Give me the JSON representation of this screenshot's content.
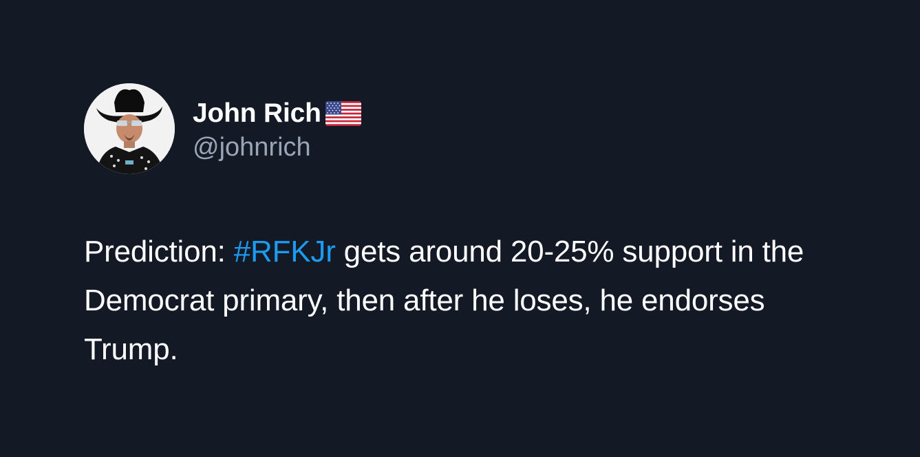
{
  "author": {
    "display_name": "John Rich",
    "flag_icon": "us-flag-icon",
    "handle": "@johnrich"
  },
  "tweet": {
    "text_before": "Prediction: ",
    "hashtag": "#RFKJr",
    "text_after": " gets around 20-25% support in the Democrat primary, then after he loses, he endorses Trump."
  },
  "colors": {
    "background": "#131a26",
    "text": "#ffffff",
    "handle": "#9aa6b6",
    "hashtag": "#1d9bf0"
  }
}
